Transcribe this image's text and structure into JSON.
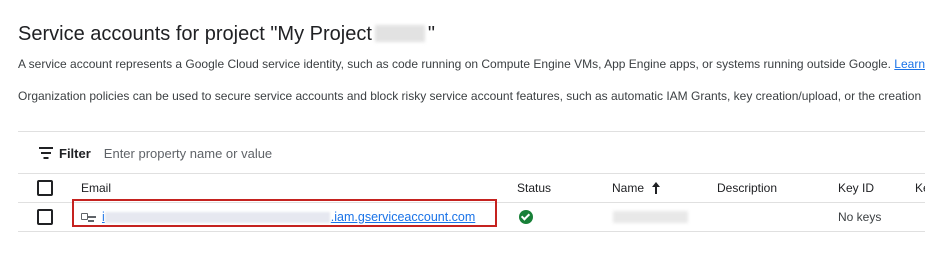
{
  "header": {
    "title_prefix": "Service accounts for project \"My Project",
    "title_suffix": "\"",
    "description_1": "A service account represents a Google Cloud service identity, such as code running on Compute Engine VMs, App Engine apps, or systems running outside Google.",
    "learn_more_label": "Learn m",
    "description_2": "Organization policies can be used to secure service accounts and block risky service account features, such as automatic IAM Grants, key creation/upload, or the creation o"
  },
  "filter": {
    "label": "Filter",
    "placeholder": "Enter property name or value",
    "icon": "filter-list-icon"
  },
  "table": {
    "columns": [
      "Email",
      "Status",
      "Name",
      "Description",
      "Key ID",
      "Ke"
    ],
    "sort_icon": "arrow-upward-icon",
    "rows": [
      {
        "email_visible_start": "i",
        "email_visible_end": ".iam.gserviceaccount.com",
        "email_icon": "service-account-key-icon",
        "status_icon": "check-circle-icon",
        "status_color": "#188038",
        "key_id": "No keys"
      }
    ]
  },
  "colors": {
    "link": "#1a73e8",
    "highlight": "#c5221f"
  }
}
